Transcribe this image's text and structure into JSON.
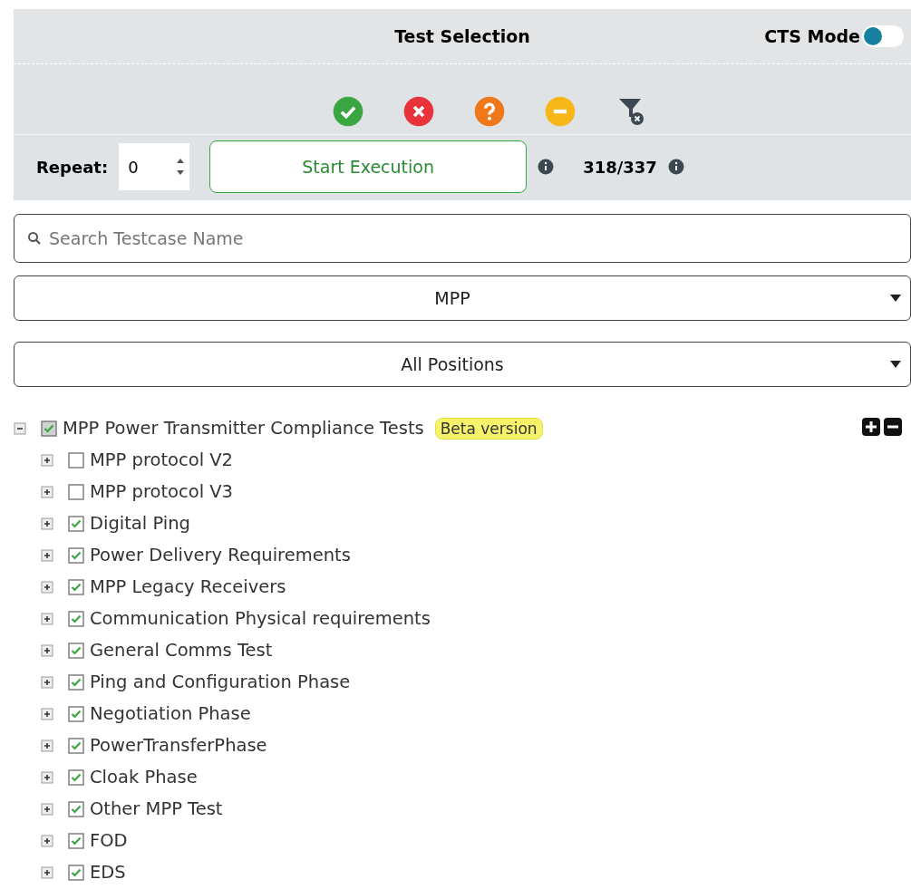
{
  "header": {
    "title": "Test Selection",
    "cts_mode": {
      "label": "CTS Mode",
      "on": false
    }
  },
  "filters": [
    {
      "kind": "pass"
    },
    {
      "kind": "fail"
    },
    {
      "kind": "unknown"
    },
    {
      "kind": "skipped"
    },
    {
      "kind": "clear"
    }
  ],
  "repeat": {
    "label": "Repeat:",
    "value": "0"
  },
  "start_button": "Start Execution",
  "count": "318/337",
  "search": {
    "placeholder": "Search Testcase Name"
  },
  "dropdowns": [
    "MPP",
    "All Positions"
  ],
  "tree": [
    {
      "label": "MPP Power Transmitter Compliance Tests",
      "badge": "Beta version",
      "checked": true,
      "expanded": true,
      "children": [
        {
          "label": "MPP protocol V2",
          "checked": false,
          "expanded": false
        },
        {
          "label": "MPP protocol V3",
          "checked": false,
          "expanded": false
        },
        {
          "label": "Digital Ping",
          "checked": true,
          "expanded": false
        },
        {
          "label": "Power Delivery Requirements",
          "checked": true,
          "expanded": false
        },
        {
          "label": "MPP Legacy Receivers",
          "checked": true,
          "expanded": false
        },
        {
          "label": "Communication Physical requirements",
          "checked": true,
          "expanded": false
        },
        {
          "label": "General Comms Test",
          "checked": true,
          "expanded": false
        },
        {
          "label": "Ping and Configuration Phase",
          "checked": true,
          "expanded": false
        },
        {
          "label": "Negotiation Phase",
          "checked": true,
          "expanded": false
        },
        {
          "label": "PowerTransferPhase",
          "checked": true,
          "expanded": false
        },
        {
          "label": "Cloak Phase",
          "checked": true,
          "expanded": false
        },
        {
          "label": "Other MPP Test",
          "checked": true,
          "expanded": false
        },
        {
          "label": "FOD",
          "checked": true,
          "expanded": false
        },
        {
          "label": "EDS",
          "checked": true,
          "expanded": false
        }
      ]
    }
  ]
}
